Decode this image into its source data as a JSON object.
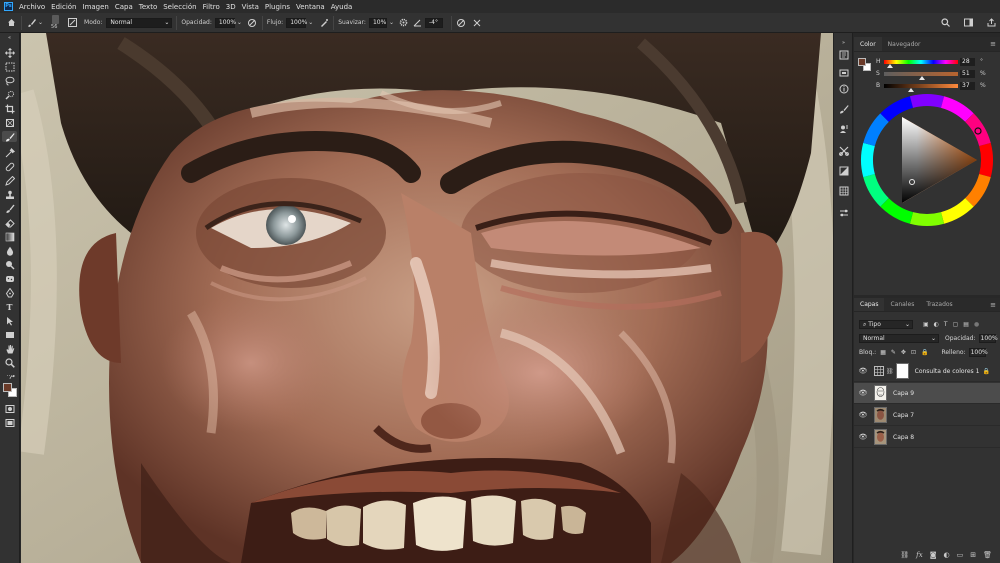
{
  "app": {
    "name": "Photoshop",
    "logo": "Ps"
  },
  "menu": [
    "Archivo",
    "Edición",
    "Imagen",
    "Capa",
    "Texto",
    "Selección",
    "Filtro",
    "3D",
    "Vista",
    "Plugins",
    "Ventana",
    "Ayuda"
  ],
  "window_controls": [
    "search-icon",
    "workspace-icon",
    "share-icon"
  ],
  "options_bar": {
    "brush_size": "56",
    "mode_label": "Modo:",
    "mode_value": "Normal",
    "opacity_label": "Opacidad:",
    "opacity_value": "100%",
    "flow_label": "Flujo:",
    "flow_value": "100%",
    "smoothing_label": "Suavizar:",
    "smoothing_value": "10%",
    "angle_value": "-4°"
  },
  "color_panel": {
    "tabs": [
      "Color",
      "Navegador"
    ],
    "active_tab": "Color",
    "foreground_color": "#6a3a28",
    "background_color": "#ffffff",
    "hsb": [
      {
        "letter": "H",
        "value": "28",
        "unit": "°",
        "fraction": 0.08
      },
      {
        "letter": "S",
        "value": "51",
        "unit": "%",
        "fraction": 0.51
      },
      {
        "letter": "B",
        "value": "37",
        "unit": "%",
        "fraction": 0.37
      }
    ]
  },
  "layers_panel": {
    "tabs": [
      "Capas",
      "Canales",
      "Trazados"
    ],
    "active_tab": "Capas",
    "filter_label": "Tipo",
    "blend_mode": "Normal",
    "opacity_label": "Opacidad:",
    "opacity_value": "100%",
    "lock_label": "Bloq.:",
    "fill_label": "Relleno:",
    "fill_value": "100%",
    "layers": [
      {
        "name": "Consulta de colores 1",
        "kind": "adjustment",
        "locked": true,
        "selected": false
      },
      {
        "name": "Capa 9",
        "kind": "sketch",
        "locked": false,
        "selected": true
      },
      {
        "name": "Capa 7",
        "kind": "painting",
        "locked": false,
        "selected": false
      },
      {
        "name": "Capa 8",
        "kind": "painting",
        "locked": false,
        "selected": false
      }
    ],
    "bottom_icons": [
      "link-icon",
      "fx-icon",
      "mask-icon",
      "adjustment-icon",
      "folder-icon",
      "new-layer-icon",
      "trash-icon"
    ]
  },
  "toolbar": [
    "move-tool",
    "marquee-tool",
    "lasso-tool",
    "quick-select-tool",
    "crop-tool",
    "frame-tool",
    "eyedropper-tool",
    "brush-tool",
    "healing-tool",
    "pencil-tool",
    "clone-stamp-tool",
    "history-brush-tool",
    "eraser-tool",
    "gradient-tool",
    "blur-tool",
    "dodge-tool",
    "pen-tool",
    "type-tool",
    "path-select-tool",
    "shape-tool",
    "hand-tool",
    "zoom-tool"
  ]
}
